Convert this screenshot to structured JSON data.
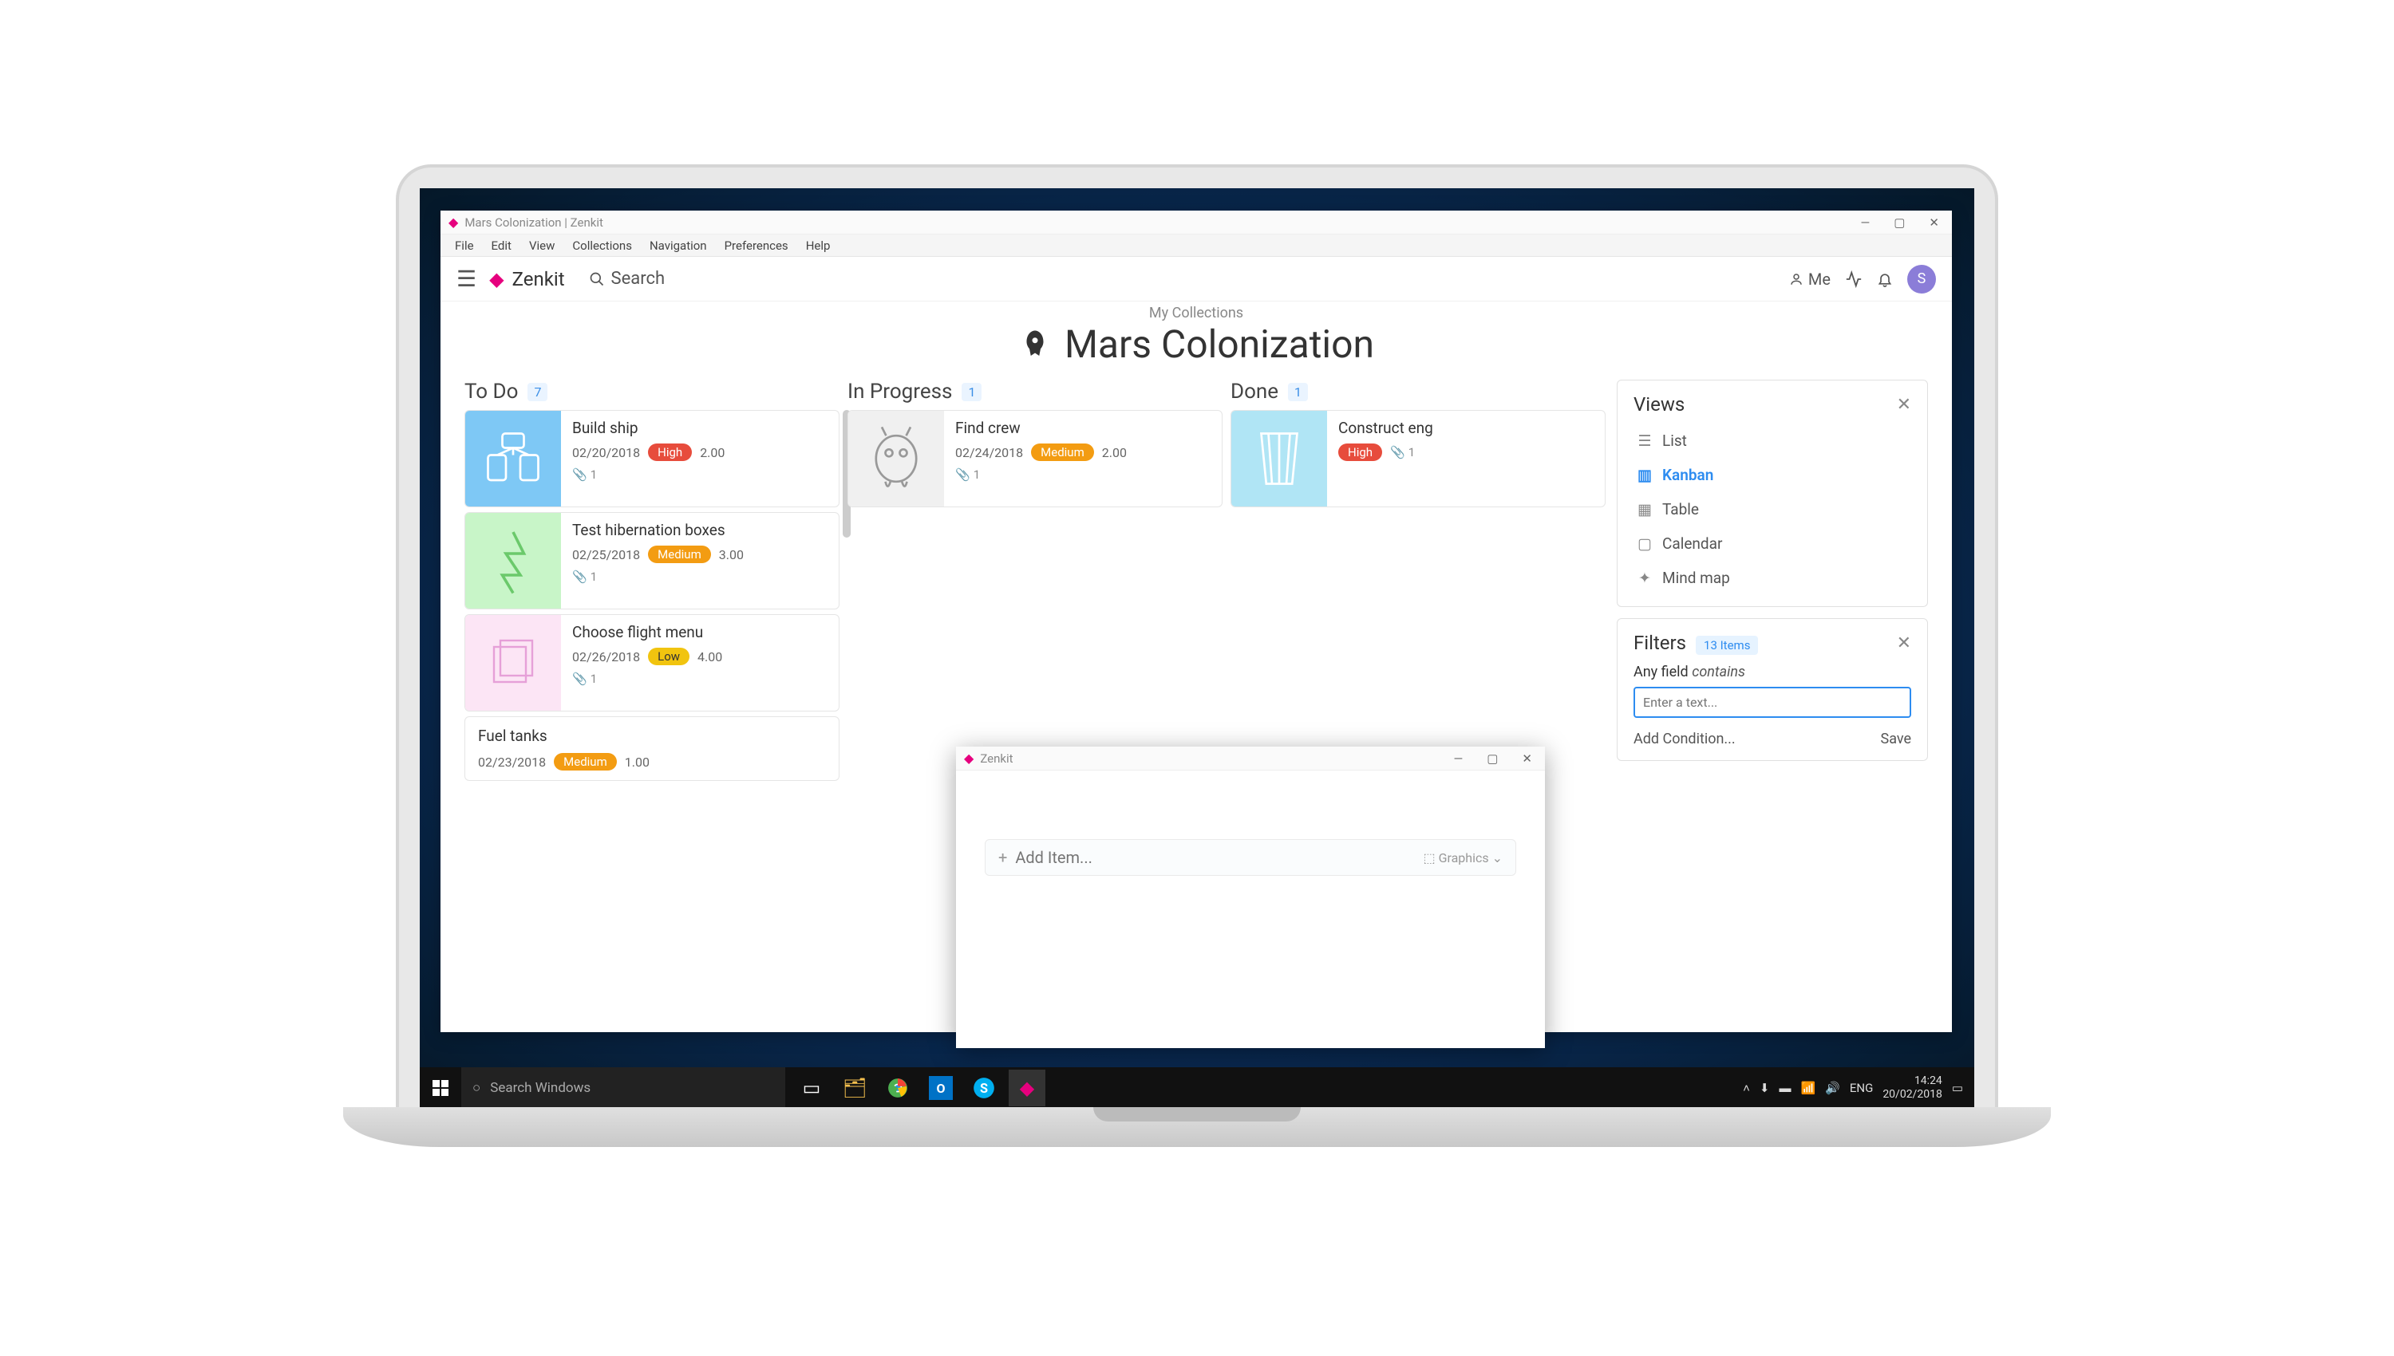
{
  "window_title": "Mars Colonization | Zenkit",
  "menubar": [
    "File",
    "Edit",
    "View",
    "Collections",
    "Navigation",
    "Preferences",
    "Help"
  ],
  "brand": "Zenkit",
  "search_label": "Search",
  "me_label": "Me",
  "avatar_initial": "S",
  "breadcrumb": "My Collections",
  "page_title": "Mars Colonization",
  "columns": {
    "todo": {
      "title": "To Do",
      "count": "7",
      "cards": [
        {
          "title": "Build ship",
          "date": "02/20/2018",
          "priority": "High",
          "priority_class": "high",
          "hours": "2.00",
          "attach": "1"
        },
        {
          "title": "Test hibernation boxes",
          "date": "02/25/2018",
          "priority": "Medium",
          "priority_class": "medium",
          "hours": "3.00",
          "attach": "1"
        },
        {
          "title": "Choose flight menu",
          "date": "02/26/2018",
          "priority": "Low",
          "priority_class": "low",
          "hours": "4.00",
          "attach": "1"
        },
        {
          "title": "Fuel tanks",
          "date": "02/23/2018",
          "priority": "Medium",
          "priority_class": "medium",
          "hours": "1.00"
        }
      ]
    },
    "inprogress": {
      "title": "In Progress",
      "count": "1",
      "cards": [
        {
          "title": "Find crew",
          "date": "02/24/2018",
          "priority": "Medium",
          "priority_class": "medium",
          "hours": "2.00",
          "attach": "1"
        }
      ]
    },
    "done": {
      "title": "Done",
      "count": "1",
      "cards": [
        {
          "title": "Construct eng",
          "priority": "High",
          "priority_class": "high",
          "attach": "1"
        }
      ]
    }
  },
  "views_panel": {
    "title": "Views",
    "items": [
      "List",
      "Kanban",
      "Table",
      "Calendar",
      "Mind map"
    ],
    "active": "Kanban"
  },
  "filters_panel": {
    "title": "Filters",
    "badge": "13 Items",
    "field_label_prefix": "Any field",
    "field_label_em": "contains",
    "input_placeholder": "Enter a text...",
    "add_condition": "Add Condition...",
    "save": "Save"
  },
  "mini_window": {
    "title": "Zenkit",
    "add_item_placeholder": "Add Item...",
    "graphics_label": "Graphics"
  },
  "taskbar": {
    "search_placeholder": "Search Windows",
    "lang": "ENG",
    "time": "14:24",
    "date": "20/02/2018"
  }
}
